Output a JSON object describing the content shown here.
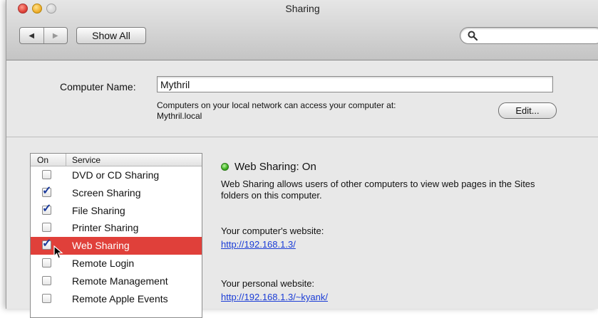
{
  "window": {
    "title": "Sharing"
  },
  "toolbar": {
    "back_icon": "back-arrow-icon",
    "forward_icon": "forward-arrow-icon",
    "show_all_label": "Show All",
    "search_placeholder": "",
    "search_icon": "magnifier-icon"
  },
  "computer_name": {
    "label": "Computer Name:",
    "value": "Mythril",
    "description_line1": "Computers on your local network can access your computer at:",
    "description_line2": "Mythril.local",
    "edit_label": "Edit..."
  },
  "services": {
    "header_on": "On",
    "header_service": "Service",
    "items": [
      {
        "label": "DVD or CD Sharing",
        "checked": false
      },
      {
        "label": "Screen Sharing",
        "checked": true
      },
      {
        "label": "File Sharing",
        "checked": true
      },
      {
        "label": "Printer Sharing",
        "checked": false
      },
      {
        "label": "Web Sharing",
        "checked": true,
        "selected": true
      },
      {
        "label": "Remote Login",
        "checked": false
      },
      {
        "label": "Remote Management",
        "checked": false
      },
      {
        "label": "Remote Apple Events",
        "checked": false
      }
    ]
  },
  "detail": {
    "status_title": "Web Sharing: On",
    "status_color": "#3cb020",
    "description": "Web Sharing allows users of other computers to view web pages in the Sites folders on this computer.",
    "computer_website_label": "Your computer's website:",
    "computer_website_link": "http://192.168.1.3/",
    "personal_website_label": "Your personal website:",
    "personal_website_link": "http://192.168.1.3/~kyank/"
  },
  "colors": {
    "selection": "#e0403a",
    "link": "#1a3cd6"
  }
}
